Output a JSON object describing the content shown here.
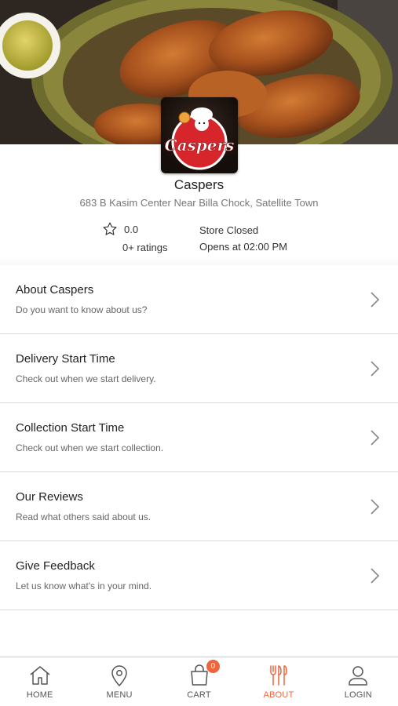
{
  "store": {
    "name": "Caspers",
    "address": "683 B Kasim Center Near Billa Chock, Satellite Town",
    "rating": "0.0",
    "ratings_count": "0+ ratings",
    "status": "Store Closed",
    "opens_at": "Opens at 02:00 PM",
    "logo_text": "Caspers"
  },
  "menu_items": [
    {
      "title": "About Caspers",
      "subtitle": "Do you want to know about us?"
    },
    {
      "title": "Delivery Start Time",
      "subtitle": "Check out when we start delivery."
    },
    {
      "title": "Collection Start Time",
      "subtitle": "Check out when we start collection."
    },
    {
      "title": "Our Reviews",
      "subtitle": "Read what others said about us."
    },
    {
      "title": "Give Feedback",
      "subtitle": "Let us know what's in your mind."
    }
  ],
  "bottom_nav": {
    "items": [
      {
        "label": "HOME",
        "icon": "home-icon"
      },
      {
        "label": "MENU",
        "icon": "location-pin-icon"
      },
      {
        "label": "CART",
        "icon": "shopping-bag-icon",
        "badge": "0"
      },
      {
        "label": "ABOUT",
        "icon": "fork-knife-icon",
        "active": true
      },
      {
        "label": "LOGIN",
        "icon": "user-icon"
      }
    ]
  },
  "colors": {
    "accent": "#f0643c",
    "text": "#222222",
    "muted": "#777777",
    "divider": "#d9d9d9"
  }
}
